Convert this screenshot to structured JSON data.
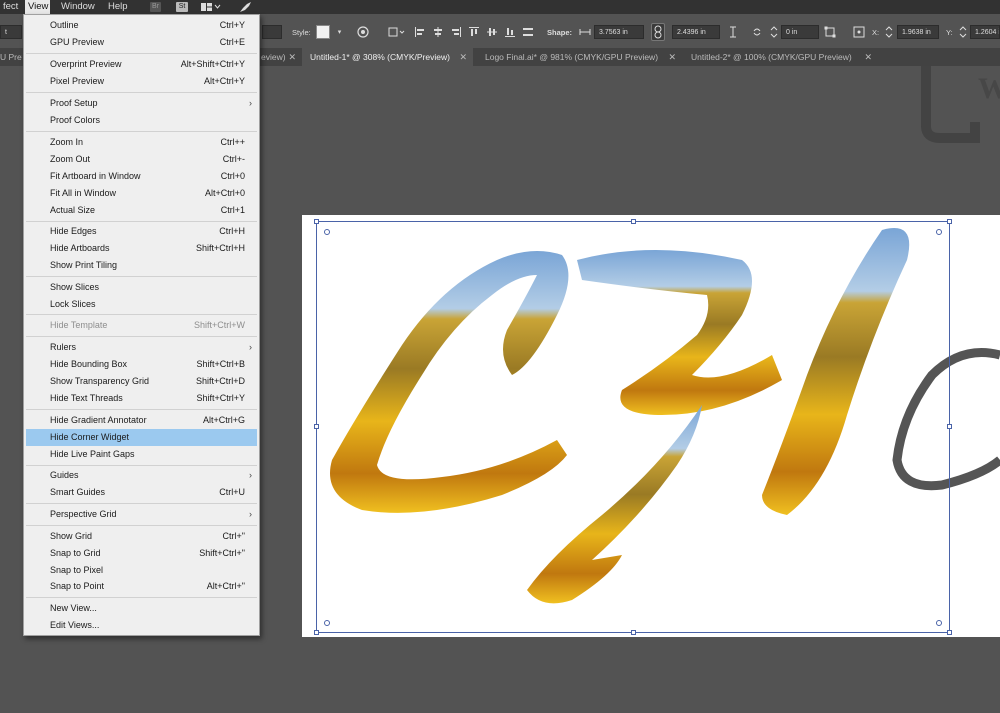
{
  "menubar": {
    "items": [
      {
        "label": "fect"
      },
      {
        "label": "View"
      },
      {
        "label": "Window"
      },
      {
        "label": "Help"
      }
    ],
    "bridge_icon": "Br",
    "stock_icon": "St"
  },
  "control_bar": {
    "style_label": "Style:",
    "shape_label": "Shape:",
    "width_value": "3.7563 in",
    "height_value": "2.4396 in",
    "corner_value": "0 in",
    "x_label": "X:",
    "x_value": "1.9638 in",
    "y_label": "Y:",
    "y_value": "1.2604 in",
    "left_select": "t"
  },
  "tabs": [
    {
      "label": "U Previ"
    },
    {
      "label": "eview)"
    },
    {
      "label": "Untitled-1* @ 308% (CMYK/Preview)"
    },
    {
      "label": "Logo Final.ai* @ 981% (CMYK/GPU Preview)"
    },
    {
      "label": "Untitled-2* @ 100% (CMYK/GPU Preview)"
    }
  ],
  "view_menu": {
    "items": [
      {
        "label": "Outline",
        "shortcut": "Ctrl+Y"
      },
      {
        "label": "GPU Preview",
        "shortcut": "Ctrl+E"
      },
      {
        "label": "Overprint Preview",
        "shortcut": "Alt+Shift+Ctrl+Y"
      },
      {
        "label": "Pixel Preview",
        "shortcut": "Alt+Ctrl+Y"
      },
      {
        "label": "Proof Setup",
        "shortcut": ""
      },
      {
        "label": "Proof Colors",
        "shortcut": ""
      },
      {
        "label": "Zoom In",
        "shortcut": "Ctrl++"
      },
      {
        "label": "Zoom Out",
        "shortcut": "Ctrl+-"
      },
      {
        "label": "Fit Artboard in Window",
        "shortcut": "Ctrl+0"
      },
      {
        "label": "Fit All in Window",
        "shortcut": "Alt+Ctrl+0"
      },
      {
        "label": "Actual Size",
        "shortcut": "Ctrl+1"
      },
      {
        "label": "Hide Edges",
        "shortcut": "Ctrl+H"
      },
      {
        "label": "Hide Artboards",
        "shortcut": "Shift+Ctrl+H"
      },
      {
        "label": "Show Print Tiling",
        "shortcut": ""
      },
      {
        "label": "Show Slices",
        "shortcut": ""
      },
      {
        "label": "Lock Slices",
        "shortcut": ""
      },
      {
        "label": "Hide Template",
        "shortcut": "Shift+Ctrl+W"
      },
      {
        "label": "Rulers",
        "shortcut": ""
      },
      {
        "label": "Hide Bounding Box",
        "shortcut": "Shift+Ctrl+B"
      },
      {
        "label": "Show Transparency Grid",
        "shortcut": "Shift+Ctrl+D"
      },
      {
        "label": "Hide Text Threads",
        "shortcut": "Shift+Ctrl+Y"
      },
      {
        "label": "Hide Gradient Annotator",
        "shortcut": "Alt+Ctrl+G"
      },
      {
        "label": "Hide Corner Widget",
        "shortcut": ""
      },
      {
        "label": "Hide Live Paint Gaps",
        "shortcut": ""
      },
      {
        "label": "Guides",
        "shortcut": ""
      },
      {
        "label": "Smart Guides",
        "shortcut": "Ctrl+U"
      },
      {
        "label": "Perspective Grid",
        "shortcut": ""
      },
      {
        "label": "Show Grid",
        "shortcut": "Ctrl+\""
      },
      {
        "label": "Snap to Grid",
        "shortcut": "Shift+Ctrl+\""
      },
      {
        "label": "Snap to Pixel",
        "shortcut": ""
      },
      {
        "label": "Snap to Point",
        "shortcut": "Alt+Ctrl+\""
      },
      {
        "label": "New View...",
        "shortcut": ""
      },
      {
        "label": "Edit Views...",
        "shortcut": ""
      }
    ]
  },
  "canvas": {
    "bg_letter": "W"
  },
  "colors": {
    "highlight": "#9bc9ef",
    "selection": "#4a63a8"
  }
}
